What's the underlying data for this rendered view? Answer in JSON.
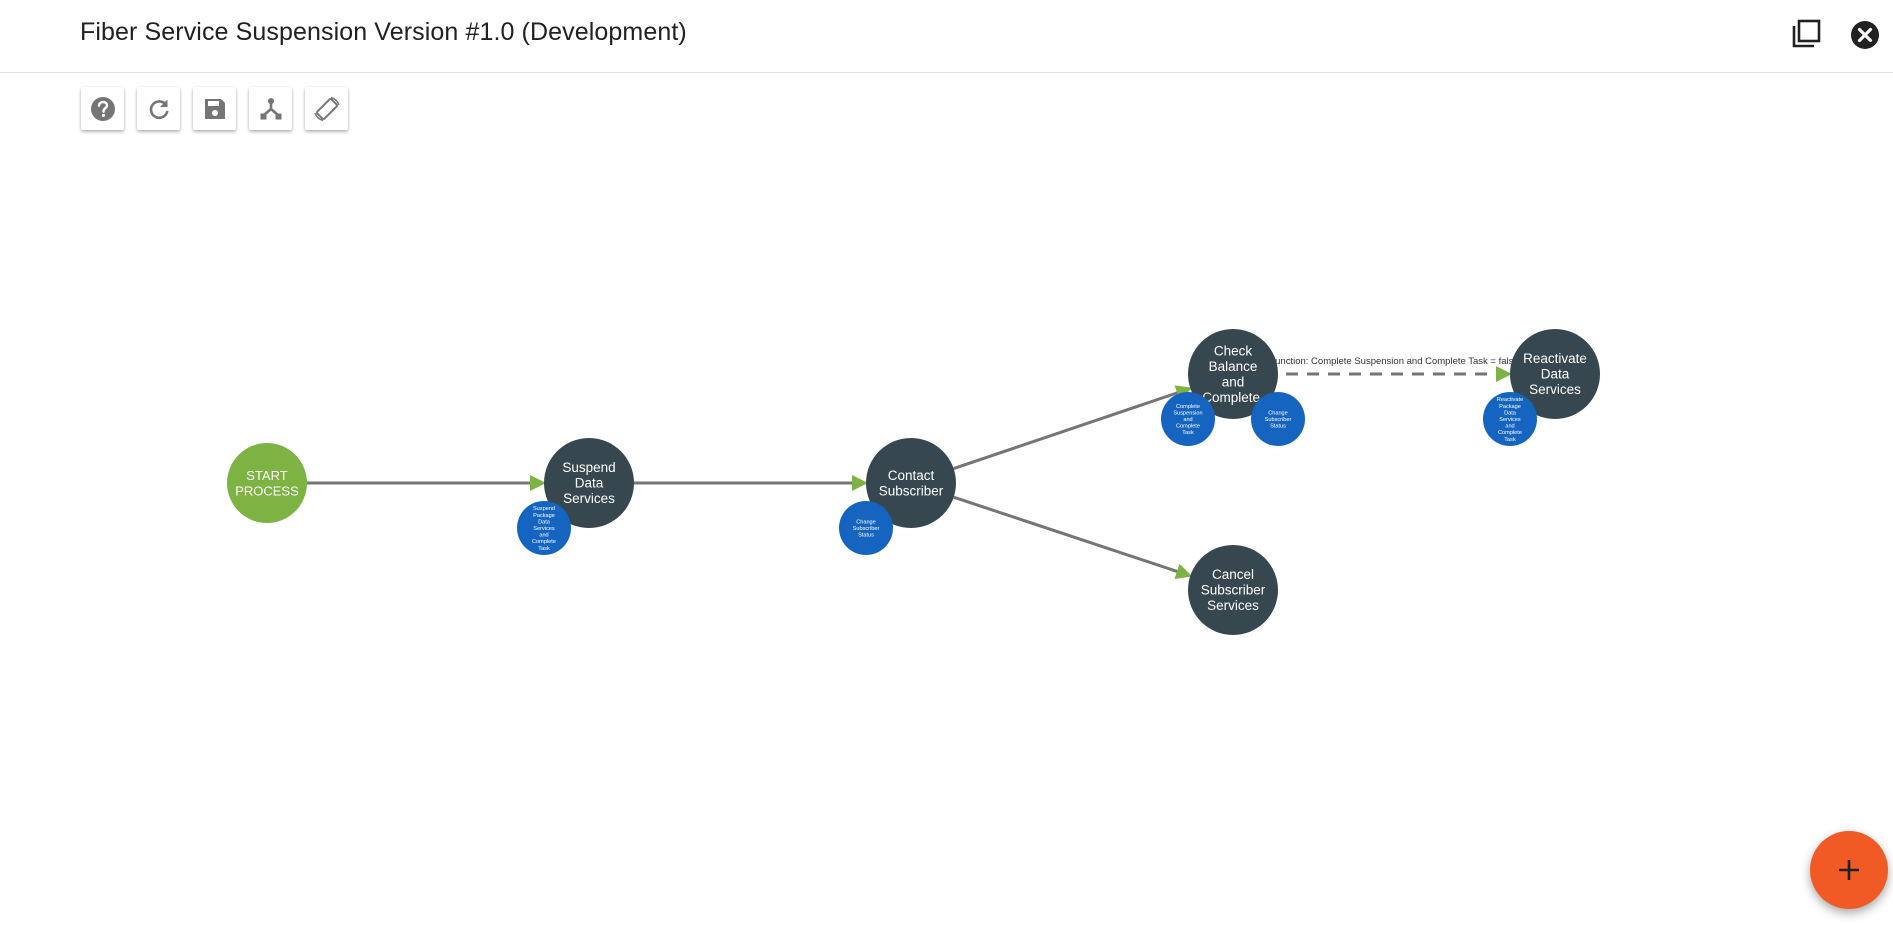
{
  "header": {
    "title": "Fiber Service Suspension Version #1.0 (Development)",
    "actions": [
      {
        "name": "restore-window",
        "icon": "restore-window-icon"
      },
      {
        "name": "close",
        "icon": "close-circle-icon"
      }
    ]
  },
  "toolbar": {
    "buttons": [
      {
        "name": "help",
        "icon": "help-circle-icon"
      },
      {
        "name": "refresh",
        "icon": "refresh-icon"
      },
      {
        "name": "save",
        "icon": "save-floppy-icon"
      },
      {
        "name": "auto-layout",
        "icon": "fork-tree-icon"
      },
      {
        "name": "rotate",
        "icon": "screen-rotation-icon"
      }
    ]
  },
  "colors": {
    "start_node": "#7cb342",
    "step_node": "#37474f",
    "task_node": "#1565c0",
    "edge": "#757575",
    "arrow": "#7cb342",
    "fab": "#f15a24"
  },
  "diagram": {
    "nodes": [
      {
        "id": "start",
        "type": "start",
        "label": [
          "START",
          "PROCESS"
        ]
      },
      {
        "id": "suspend",
        "type": "step",
        "label": [
          "Suspend",
          "Data",
          "Services"
        ]
      },
      {
        "id": "contact",
        "type": "step",
        "label": [
          "Contact",
          "Subscriber"
        ]
      },
      {
        "id": "check",
        "type": "step",
        "label": [
          "Check",
          "Balance",
          "and",
          "Complete."
        ]
      },
      {
        "id": "reactivate",
        "type": "step",
        "label": [
          "Reactivate",
          "Data",
          "Services"
        ]
      },
      {
        "id": "cancel",
        "type": "step",
        "label": [
          "Cancel",
          "Subscriber",
          "Services"
        ]
      }
    ],
    "tasks": [
      {
        "id": "t1",
        "parent": "suspend",
        "label": [
          "Suspend",
          "Package",
          "Data",
          "Services",
          "and",
          "Complete",
          "Task"
        ]
      },
      {
        "id": "t2",
        "parent": "contact",
        "label": [
          "Change",
          "Subscriber",
          "Status"
        ]
      },
      {
        "id": "t3",
        "parent": "check",
        "label": [
          "Complete",
          "Suspension",
          "and",
          "Complete",
          "Task"
        ]
      },
      {
        "id": "t4",
        "parent": "check",
        "label": [
          "Change",
          "Subscriber",
          "Status"
        ]
      },
      {
        "id": "t5",
        "parent": "reactivate",
        "label": [
          "Reactivate",
          "Package",
          "Data",
          "Services",
          "and",
          "Complete",
          "Task"
        ]
      }
    ],
    "edges": [
      {
        "from": "start",
        "to": "suspend",
        "style": "solid",
        "label": ""
      },
      {
        "from": "suspend",
        "to": "contact",
        "style": "solid",
        "label": ""
      },
      {
        "from": "contact",
        "to": "check",
        "style": "solid",
        "label": ""
      },
      {
        "from": "contact",
        "to": "cancel",
        "style": "solid",
        "label": ""
      },
      {
        "from": "check",
        "to": "reactivate",
        "style": "dashed",
        "label": "Function: Complete Suspension and Complete Task = false"
      }
    ]
  },
  "fab": {
    "name": "add",
    "icon": "plus-icon"
  }
}
